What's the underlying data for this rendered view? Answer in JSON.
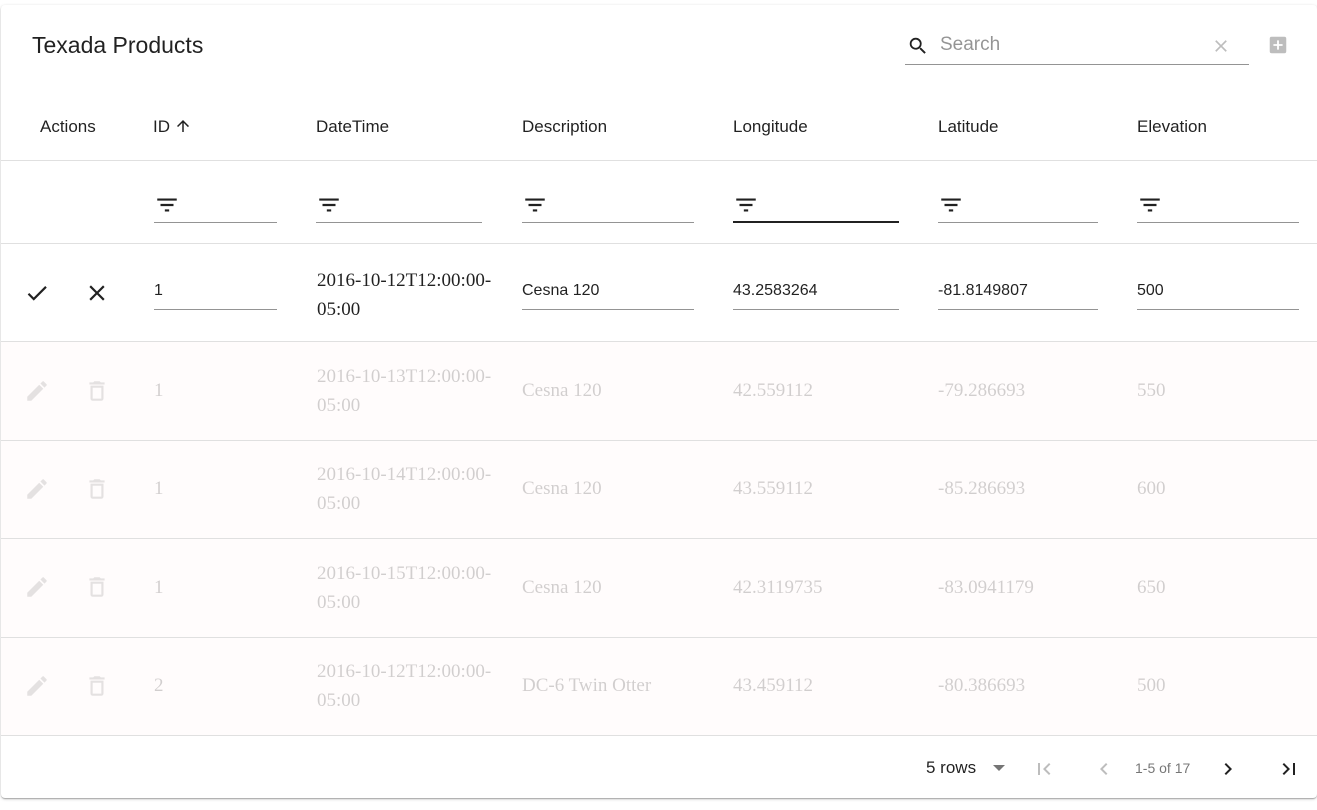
{
  "toolbar": {
    "title": "Texada Products",
    "search_placeholder": "Search",
    "search_value": ""
  },
  "columns": {
    "actions": "Actions",
    "id": "ID",
    "datetime": "DateTime",
    "description": "Description",
    "longitude": "Longitude",
    "latitude": "Latitude",
    "elevation": "Elevation"
  },
  "edit_row": {
    "id": "1",
    "datetime": "2016-10-12T12:00:00-05:00",
    "description": "Cesna 120",
    "longitude": "43.2583264",
    "latitude": "-81.8149807",
    "elevation": "500"
  },
  "rows": [
    {
      "id": "1",
      "datetime": "2016-10-13T12:00:00-05:00",
      "description": "Cesna 120",
      "longitude": "42.559112",
      "latitude": "-79.286693",
      "elevation": "550"
    },
    {
      "id": "1",
      "datetime": "2016-10-14T12:00:00-05:00",
      "description": "Cesna 120",
      "longitude": "43.559112",
      "latitude": "-85.286693",
      "elevation": "600"
    },
    {
      "id": "1",
      "datetime": "2016-10-15T12:00:00-05:00",
      "description": "Cesna 120",
      "longitude": "42.3119735",
      "latitude": "-83.0941179",
      "elevation": "650"
    },
    {
      "id": "2",
      "datetime": "2016-10-12T12:00:00-05:00",
      "description": "DC-6 Twin Otter",
      "longitude": "43.459112",
      "latitude": "-80.386693",
      "elevation": "500"
    }
  ],
  "pagination": {
    "rows_per_page": "5 rows",
    "range": "1-5 of 17"
  }
}
